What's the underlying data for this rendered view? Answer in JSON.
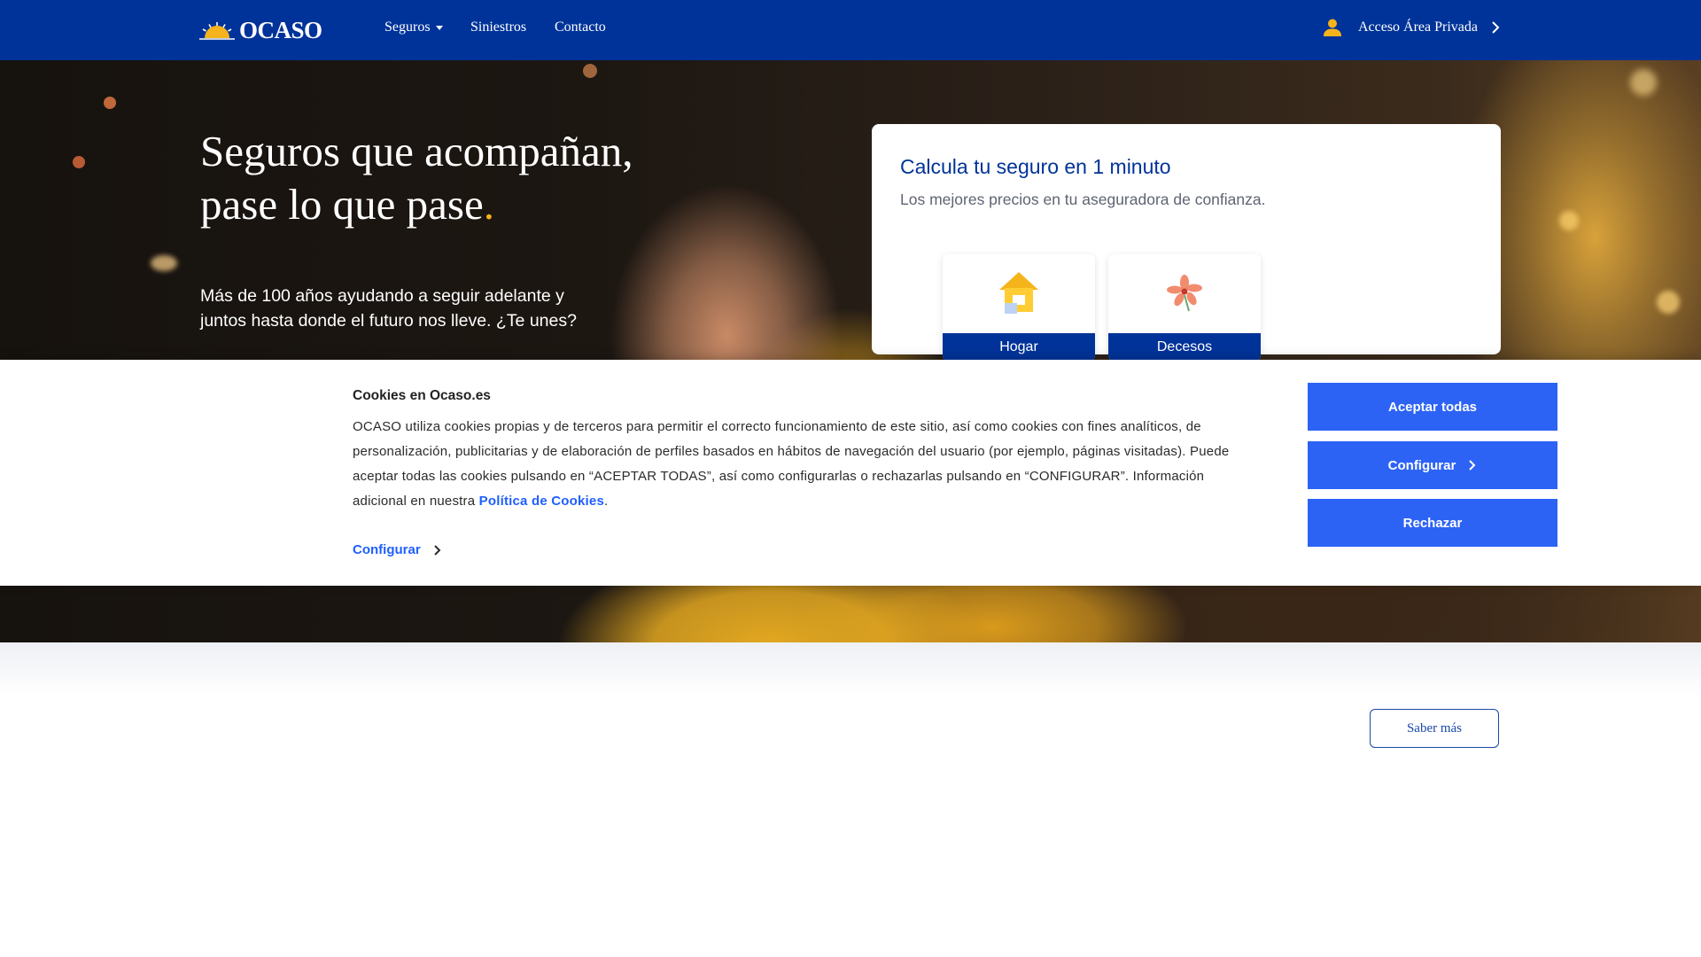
{
  "header": {
    "logo_text": "OCASO",
    "nav": [
      {
        "label": "Seguros",
        "has_dropdown": true
      },
      {
        "label": "Siniestros"
      },
      {
        "label": "Contacto"
      }
    ],
    "private_area_label": "Acceso Área Privada"
  },
  "hero": {
    "title_line1": "Seguros que acompañan,",
    "title_line2": "pase lo que pase",
    "title_dot": ".",
    "subtitle": "Más de 100 años ayudando a seguir adelante y juntos hasta donde el futuro nos lleve. ¿Te unes?"
  },
  "calculator": {
    "title": "Calcula tu seguro en 1 minuto",
    "subtitle": "Los mejores precios en tu aseguradora de confianza.",
    "products": [
      {
        "label": "Hogar",
        "icon": "house-icon"
      },
      {
        "label": "Decesos",
        "icon": "flower-icon"
      }
    ]
  },
  "cookies": {
    "title": "Cookies en Ocaso.es",
    "text_line1": "OCASO utiliza cookies propias y de terceros para permitir el correcto funcionamiento de este sitio, así como cookies con fines analíticos, de personalización, publicitarias y de elaboración de perfiles basados en hábitos de navegación del usuario (por ejemplo, páginas visitadas). Puede aceptar todas las cookies pulsando en “ACEPTAR TODAS”, así como configurarlas o rechazarlas pulsando en “CONFIGURAR”. Información adicional en nuestra ",
    "policy_link": "Política de Cookies",
    "text_end": ".",
    "config_link": "Configurar",
    "accept_button": "Aceptar todas",
    "config_button": "Configurar",
    "reject_button": "Rechazar"
  },
  "lower": {
    "saber_mas": "Saber más"
  },
  "colors": {
    "brand_blue": "#003399",
    "accent_yellow": "#f5b41b",
    "button_blue": "#2d63f5",
    "link_blue": "#1f5fff"
  }
}
